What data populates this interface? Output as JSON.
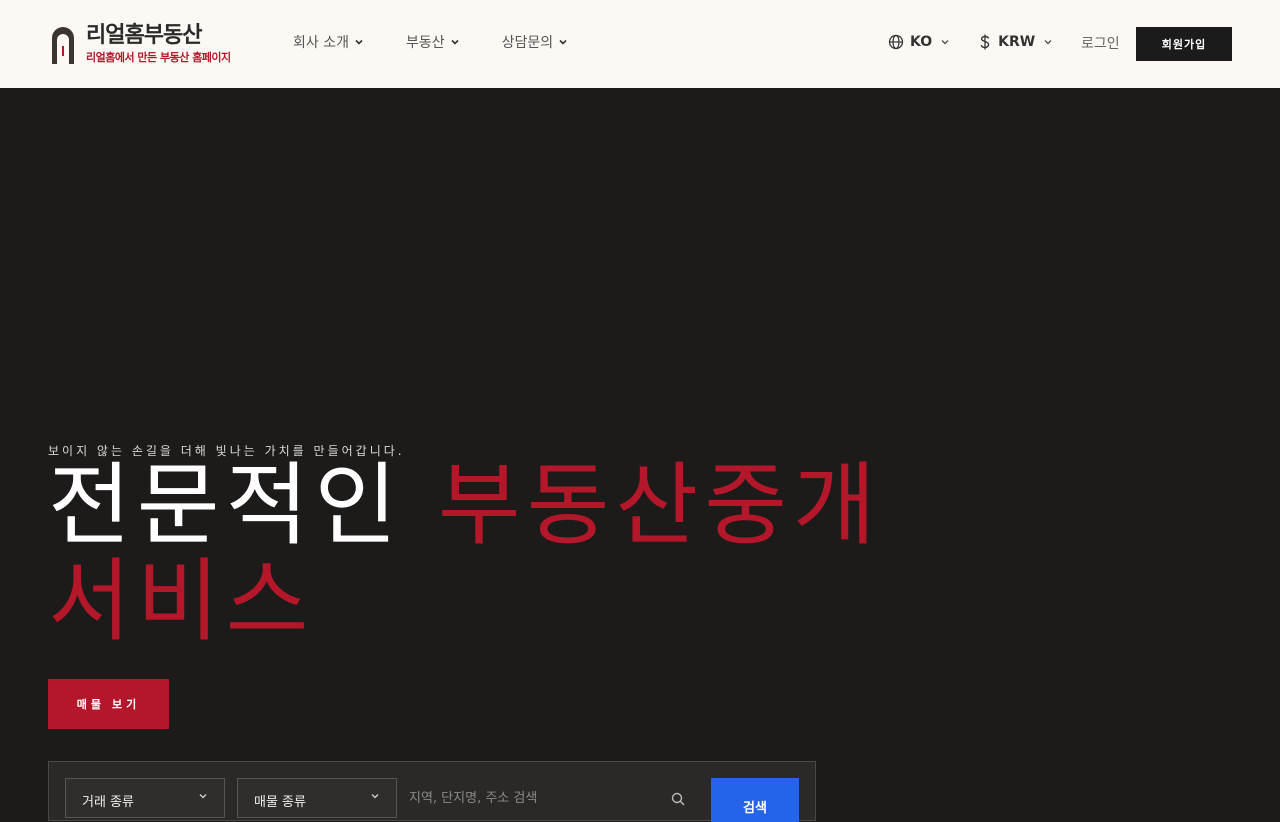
{
  "brand": {
    "title": "리얼홈부동산",
    "subtitle": "리얼홈에서 만든 부동산 홈페이지",
    "colors": {
      "accent": "#b5172a",
      "dark": "#1b1b1b",
      "header_bg": "#fcf9f4",
      "hero_bg": "#1c1b1a",
      "search_blue": "#2563eb"
    }
  },
  "nav": {
    "items": [
      {
        "label": "회사 소개",
        "icon": "chevron-down-icon"
      },
      {
        "label": "부동산",
        "icon": "chevron-down-icon"
      },
      {
        "label": "상담문의",
        "icon": "chevron-down-icon"
      }
    ]
  },
  "utility": {
    "language": {
      "label": "KO",
      "icon": "globe-icon"
    },
    "currency": {
      "label": "KRW",
      "icon": "dollar-icon"
    },
    "login_label": "로그인",
    "signup_label": "회원가입"
  },
  "hero": {
    "tagline": "보이지 않는 손길을 더해 빛나는 가치를 만들어갑니다.",
    "headline_white": "전문적인 ",
    "headline_red_1": "부동산중개",
    "headline_red_2": "서비스",
    "cta_label": "매물 보기"
  },
  "search": {
    "deal_type": "거래 종류",
    "property_type": "매물 종류",
    "placeholder": "지역, 단지명, 주소 검색",
    "button_label": "검색"
  }
}
